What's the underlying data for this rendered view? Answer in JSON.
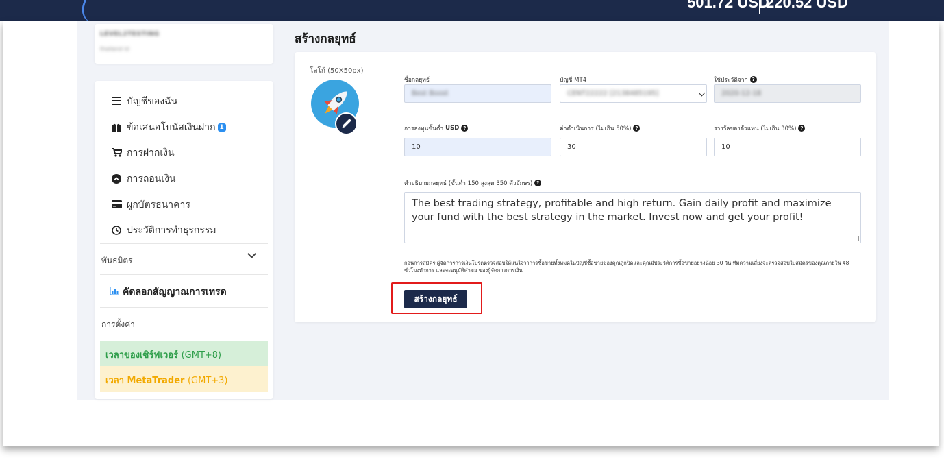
{
  "header": {
    "balance_1": "501.72 USD",
    "balance_2": "220.52 USD"
  },
  "user": {
    "username": "LEVEL2TESTING",
    "subtitle": "thailand id"
  },
  "sidebar": {
    "items": [
      {
        "label": "บัญชีของฉัน",
        "icon": "list-icon"
      },
      {
        "label": "ข้อเสนอโบนัสเงินฝาก",
        "icon": "gift-icon",
        "badge": "1"
      },
      {
        "label": "การฝากเงิน",
        "icon": "cart-icon"
      },
      {
        "label": "การถอนเงิน",
        "icon": "chevron-circle-icon"
      },
      {
        "label": "ผูกบัตรธนาคาร",
        "icon": "credit-card-icon"
      },
      {
        "label": "ประวัติการทำธุรกรรม",
        "icon": "clock-icon"
      }
    ],
    "partner_label": "พันธมิตร",
    "copytrade_label": "คัดลอกสัญญาณการเทรด",
    "settings_label": "การตั้งค่า",
    "server_time_label": "เวลาของเซิร์ฟเวอร์",
    "server_time_tz": "(GMT+8)",
    "mt_time_label": "เวลา MetaTrader",
    "mt_time_tz": "(GMT+3)"
  },
  "page": {
    "title": "สร้างกลยุทธ์"
  },
  "form": {
    "logo_label": "โลโก้ (50X50px)",
    "strategy_name_label": "ชื่อกลยุทธ์",
    "strategy_name_value": "Best Boost",
    "mt4_account_label": "บัญชี MT4",
    "mt4_account_value": "CENT22222 [2138485195]",
    "history_from_label": "ใช้ประวัติจาก",
    "history_from_value": "2020-12-18",
    "min_investment_label": "การลงทุนขั้นต่ำ",
    "min_investment_unit": "USD",
    "min_investment_value": "10",
    "management_fee_label": "ค่าดำเนินการ (ไม่เกิน 50%)",
    "management_fee_value": "30",
    "agent_reward_label": "รางวัลของตัวแทน (ไม่เกิน 30%)",
    "agent_reward_value": "10",
    "description_label": "คำอธิบายกลยุทธ์ (ขั้นต่ำ 150 สูงสุด 350 ตัวอักษร)",
    "description_value": "The best trading strategy, profitable and high return. Gain daily profit and maximize your fund with the best strategy in the market. Invest now and get your profit!",
    "notice": "ก่อนการสมัคร ผู้จัดการการเงินโปรดตรวจสอบให้แน่ใจว่าการซื้อขายทั้งหมดในบัญชีซื้อขายของคุณถูกปิดและคุณมีประวัติการซื้อขายอย่างน้อย 30 วัน ทีมความเสี่ยงจะตรวจสอบใบสมัครของคุณภายใน 48 ชั่วโมงทำการ และจะอนุมัติคำขอ ของผู้จัดการการเงิน",
    "submit_label": "สร้างกลยุทธ์",
    "help_icon_glyph": "?"
  },
  "colors": {
    "navy": "#1c2a4a",
    "accent_blue": "#2b8ff0",
    "server_green": "#2e9e4a",
    "mt_yellow": "#f2a900",
    "highlight_red": "#e21b1b"
  }
}
